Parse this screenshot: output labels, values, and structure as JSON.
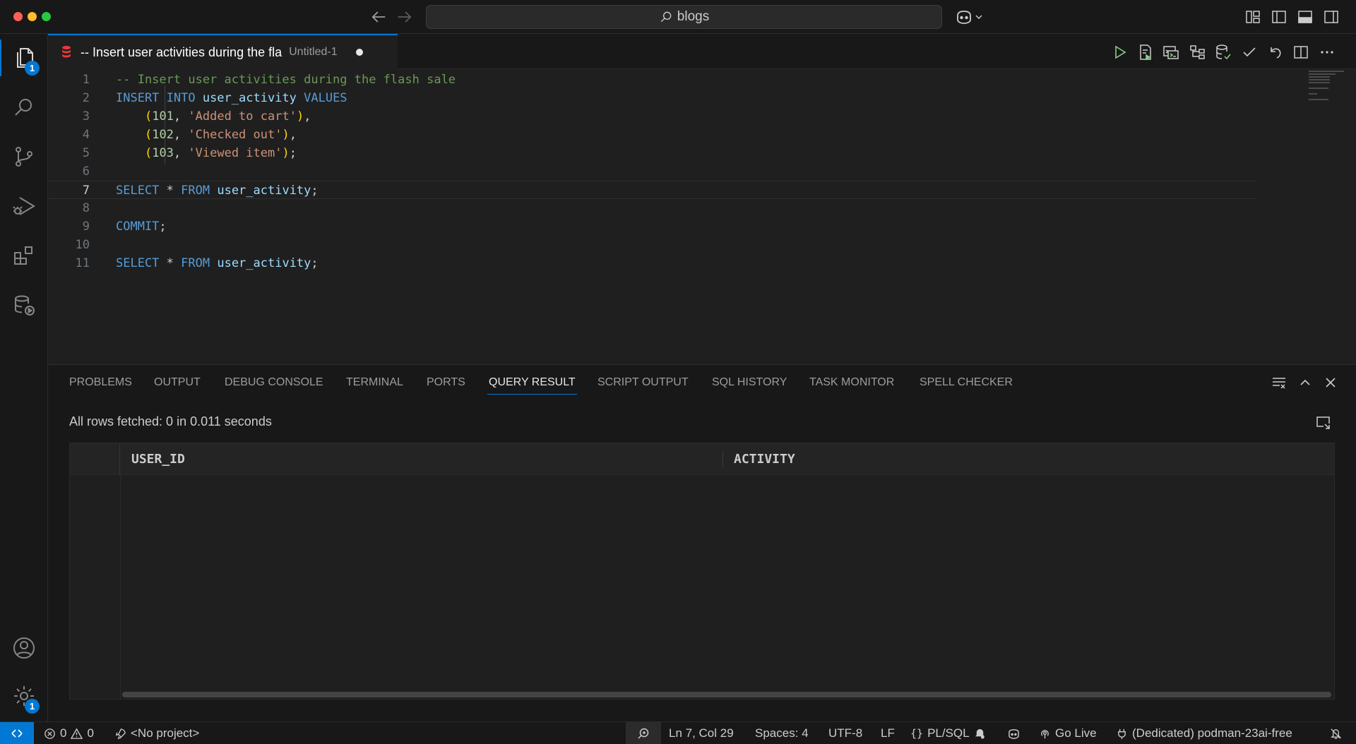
{
  "titlebar": {
    "search_text": "blogs"
  },
  "activity_bar": {
    "items": [
      {
        "name": "explorer",
        "badge": "1"
      },
      {
        "name": "search"
      },
      {
        "name": "source-control"
      },
      {
        "name": "run-and-debug"
      },
      {
        "name": "extensions"
      },
      {
        "name": "sql-developer"
      }
    ],
    "accounts_label": "Accounts",
    "manage_badge": "1"
  },
  "editor_tab": {
    "title": "-- Insert user activities during the fla",
    "description": "Untitled-1",
    "modified": true
  },
  "editor": {
    "lines": [
      {
        "n": "1",
        "tokens": [
          {
            "t": "-- Insert user activities during the flash sale",
            "c": "comment"
          }
        ]
      },
      {
        "n": "2",
        "tokens": [
          {
            "t": "INSERT INTO ",
            "c": "kw"
          },
          {
            "t": "user_activity",
            "c": "id"
          },
          {
            "t": " VALUES",
            "c": "kw"
          }
        ]
      },
      {
        "n": "3",
        "tokens": [
          {
            "t": "    ",
            "c": "plain"
          },
          {
            "t": "(",
            "c": "paren"
          },
          {
            "t": "101",
            "c": "num"
          },
          {
            "t": ", ",
            "c": "plain"
          },
          {
            "t": "'Added to cart'",
            "c": "str"
          },
          {
            "t": ")",
            "c": "paren"
          },
          {
            "t": ",",
            "c": "plain"
          }
        ]
      },
      {
        "n": "4",
        "tokens": [
          {
            "t": "    ",
            "c": "plain"
          },
          {
            "t": "(",
            "c": "paren"
          },
          {
            "t": "102",
            "c": "num"
          },
          {
            "t": ", ",
            "c": "plain"
          },
          {
            "t": "'Checked out'",
            "c": "str"
          },
          {
            "t": ")",
            "c": "paren"
          },
          {
            "t": ",",
            "c": "plain"
          }
        ]
      },
      {
        "n": "5",
        "tokens": [
          {
            "t": "    ",
            "c": "plain"
          },
          {
            "t": "(",
            "c": "paren"
          },
          {
            "t": "103",
            "c": "num"
          },
          {
            "t": ", ",
            "c": "plain"
          },
          {
            "t": "'Viewed item'",
            "c": "str"
          },
          {
            "t": ")",
            "c": "paren"
          },
          {
            "t": ";",
            "c": "plain"
          }
        ]
      },
      {
        "n": "6",
        "tokens": []
      },
      {
        "n": "7",
        "current": true,
        "tokens": [
          {
            "t": "SELECT",
            "c": "kw"
          },
          {
            "t": " * ",
            "c": "plain"
          },
          {
            "t": "FROM",
            "c": "kw"
          },
          {
            "t": " ",
            "c": "plain"
          },
          {
            "t": "user_activity",
            "c": "id"
          },
          {
            "t": ";",
            "c": "plain"
          }
        ]
      },
      {
        "n": "8",
        "tokens": []
      },
      {
        "n": "9",
        "tokens": [
          {
            "t": "COMMIT",
            "c": "kw"
          },
          {
            "t": ";",
            "c": "plain"
          }
        ]
      },
      {
        "n": "10",
        "tokens": []
      },
      {
        "n": "11",
        "tokens": [
          {
            "t": "SELECT",
            "c": "kw"
          },
          {
            "t": " * ",
            "c": "plain"
          },
          {
            "t": "FROM",
            "c": "kw"
          },
          {
            "t": " ",
            "c": "plain"
          },
          {
            "t": "user_activity",
            "c": "id"
          },
          {
            "t": ";",
            "c": "plain"
          }
        ]
      }
    ]
  },
  "panel": {
    "tabs": [
      {
        "label": "PROBLEMS"
      },
      {
        "label": "OUTPUT"
      },
      {
        "label": "DEBUG CONSOLE"
      },
      {
        "label": "TERMINAL"
      },
      {
        "label": "PORTS"
      },
      {
        "label": "QUERY RESULT",
        "active": true
      },
      {
        "label": "SCRIPT OUTPUT"
      },
      {
        "label": "SQL HISTORY"
      },
      {
        "label": "TASK MONITOR"
      },
      {
        "label": "SPELL CHECKER"
      }
    ],
    "result_status": "All rows fetched: 0 in 0.011 seconds",
    "columns": [
      "USER_ID",
      "ACTIVITY"
    ]
  },
  "statusbar": {
    "errors": "0",
    "warnings": "0",
    "project": "<No project>",
    "cursor": "Ln 7, Col 29",
    "spaces": "Spaces: 4",
    "encoding": "UTF-8",
    "eol": "LF",
    "language": "PL/SQL",
    "go_live": "Go Live",
    "connection": "(Dedicated) podman-23ai-free"
  },
  "colors": {
    "accent": "#0078d4",
    "background": "#1f1f1f",
    "chrome": "#181818",
    "db_icon": "#e8383b"
  }
}
